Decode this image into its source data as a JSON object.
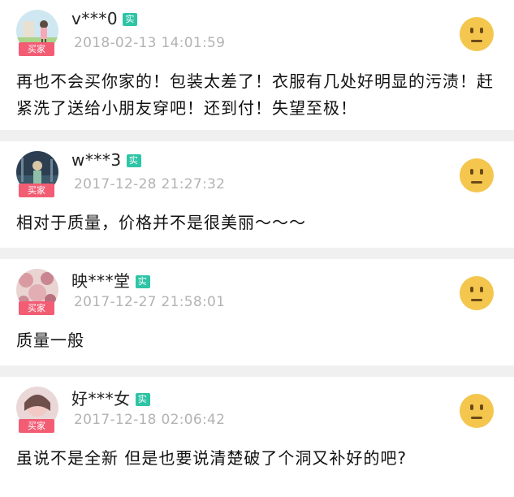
{
  "reviews": [
    {
      "username": "v***0",
      "verified_label": "实",
      "buyer_label": "买家",
      "timestamp": "2018-02-13 14:01:59",
      "comment": "再也不会买你家的！包装太差了！衣服有几处好明显的污渍！赶紧洗了送给小朋友穿吧！还到付！失望至极！",
      "rating_icon": "neutral-face-icon"
    },
    {
      "username": "w***3",
      "verified_label": "实",
      "buyer_label": "买家",
      "timestamp": "2017-12-28 21:27:32",
      "comment": "相对于质量，价格并不是很美丽～～～",
      "rating_icon": "neutral-face-icon"
    },
    {
      "username": "映***堂",
      "verified_label": "实",
      "buyer_label": "买家",
      "timestamp": "2017-12-27 21:58:01",
      "comment": "质量一般",
      "rating_icon": "neutral-face-icon"
    },
    {
      "username": "好***女",
      "verified_label": "实",
      "buyer_label": "买家",
      "timestamp": "2017-12-18 02:06:42",
      "comment": "虽说不是全新 但是也要说清楚破了个洞又补好的吧?",
      "rating_icon": "neutral-face-icon"
    }
  ],
  "colors": {
    "background": "#f0f0f0",
    "buyer_badge": "#f25d74",
    "verified_badge": "#2ec4a6",
    "rating_face": "#f4c64e",
    "timestamp": "#b3b3b3"
  }
}
